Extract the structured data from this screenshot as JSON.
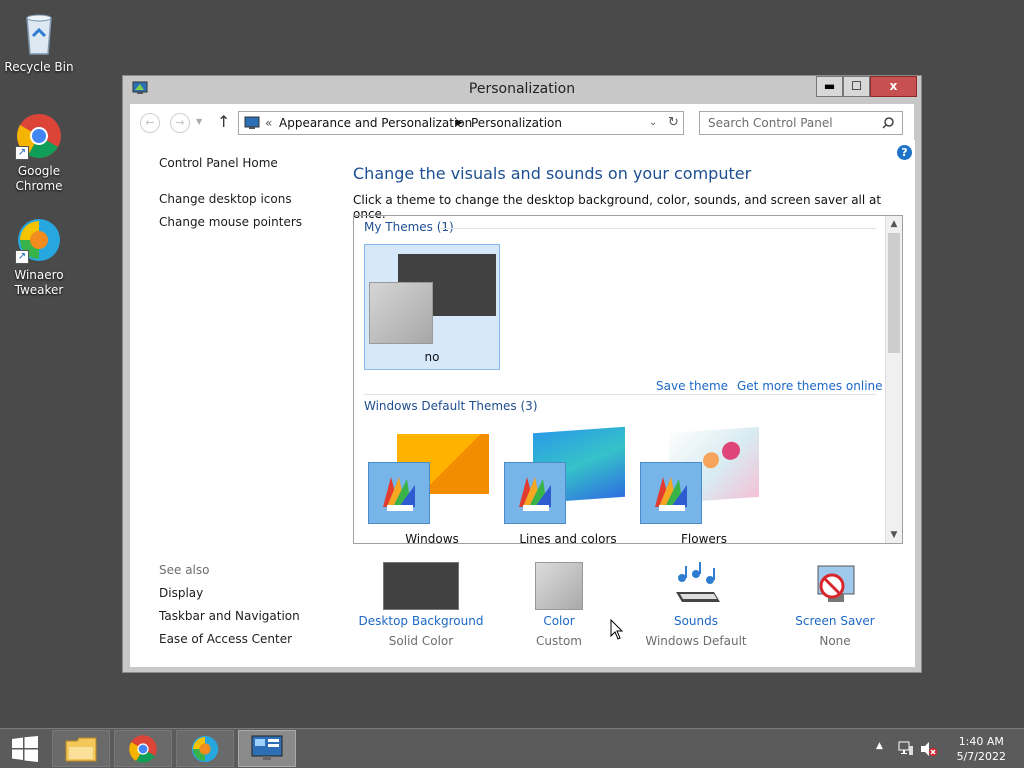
{
  "desktop": {
    "icons": [
      {
        "label": "Recycle Bin"
      },
      {
        "label": "Google\nChrome"
      },
      {
        "label": "Winaero\nTweaker"
      }
    ]
  },
  "window": {
    "title": "Personalization",
    "controls": {
      "minimize": "▬",
      "maximize": "☐",
      "close": "x"
    }
  },
  "nav": {
    "breadcrumb_prefix": "«",
    "breadcrumb": [
      "Appearance and Personalization",
      "Personalization"
    ],
    "search_placeholder": "Search Control Panel"
  },
  "left_nav": {
    "home": "Control Panel Home",
    "items": [
      "Change desktop icons",
      "Change mouse pointers"
    ]
  },
  "see_also": {
    "heading": "See also",
    "items": [
      "Display",
      "Taskbar and Navigation",
      "Ease of Access Center"
    ]
  },
  "main": {
    "title": "Change the visuals and sounds on your computer",
    "subtitle": "Click a theme to change the desktop background, color, sounds, and screen saver all at once."
  },
  "themes": {
    "my_themes_heading": "My Themes (1)",
    "my_themes": [
      {
        "name": "no"
      }
    ],
    "save_theme": "Save theme",
    "get_more": "Get more themes online",
    "default_heading": "Windows Default Themes (3)",
    "default_themes": [
      {
        "name": "Windows"
      },
      {
        "name": "Lines and colors"
      },
      {
        "name": "Flowers"
      }
    ]
  },
  "bottom": {
    "items": [
      {
        "label": "Desktop Background",
        "value": "Solid Color"
      },
      {
        "label": "Color",
        "value": "Custom"
      },
      {
        "label": "Sounds",
        "value": "Windows Default"
      },
      {
        "label": "Screen Saver",
        "value": "None"
      }
    ]
  },
  "taskbar": {
    "time": "1:40 AM",
    "date": "5/7/2022"
  },
  "colors": {
    "desktop": "#4a4a4a",
    "link": "#1d68c7",
    "heading": "#1d4f91",
    "close_button": "#c75050"
  }
}
